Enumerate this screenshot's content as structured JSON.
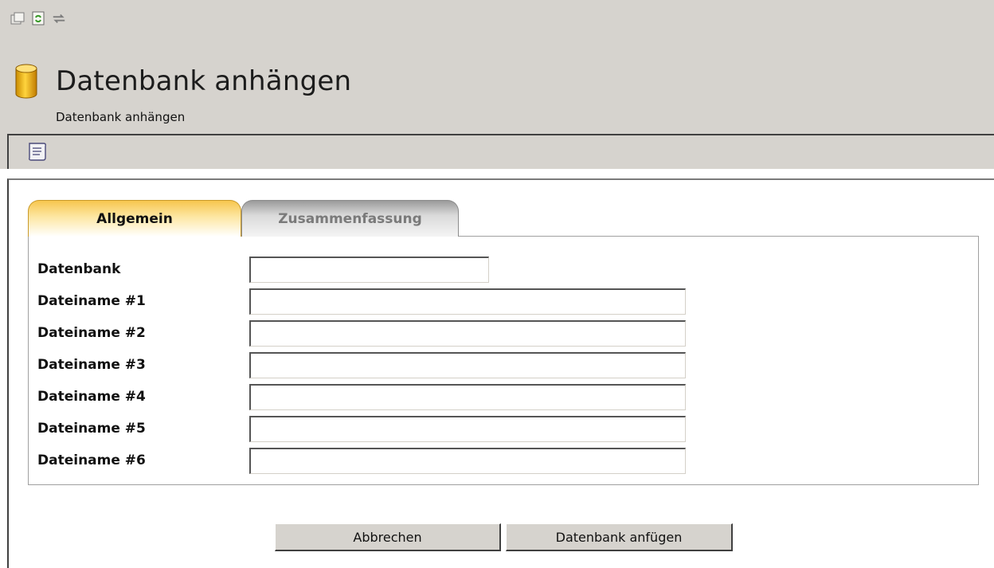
{
  "toolbar": {
    "icons": [
      "export-icon",
      "refresh-icon",
      "sync-icon"
    ]
  },
  "header": {
    "title": "Datenbank anhängen",
    "subtitle": "Datenbank anhängen",
    "icon": "database-icon"
  },
  "secondary_toolbar": {
    "icons": [
      "script-icon"
    ]
  },
  "tabs": [
    {
      "label": "Allgemein",
      "active": true
    },
    {
      "label": "Zusammenfassung",
      "active": false
    }
  ],
  "form": {
    "fields": [
      {
        "label": "Datenbank",
        "value": ""
      },
      {
        "label": "Dateiname #1",
        "value": ""
      },
      {
        "label": "Dateiname #2",
        "value": ""
      },
      {
        "label": "Dateiname #3",
        "value": ""
      },
      {
        "label": "Dateiname #4",
        "value": ""
      },
      {
        "label": "Dateiname #5",
        "value": ""
      },
      {
        "label": "Dateiname #6",
        "value": ""
      }
    ]
  },
  "buttons": {
    "cancel": "Abbrechen",
    "submit": "Datenbank anfügen"
  },
  "colors": {
    "chrome": "#d6d3ce",
    "active_tab": "#f7c64e",
    "inactive_tab": "#9a9a9a"
  }
}
